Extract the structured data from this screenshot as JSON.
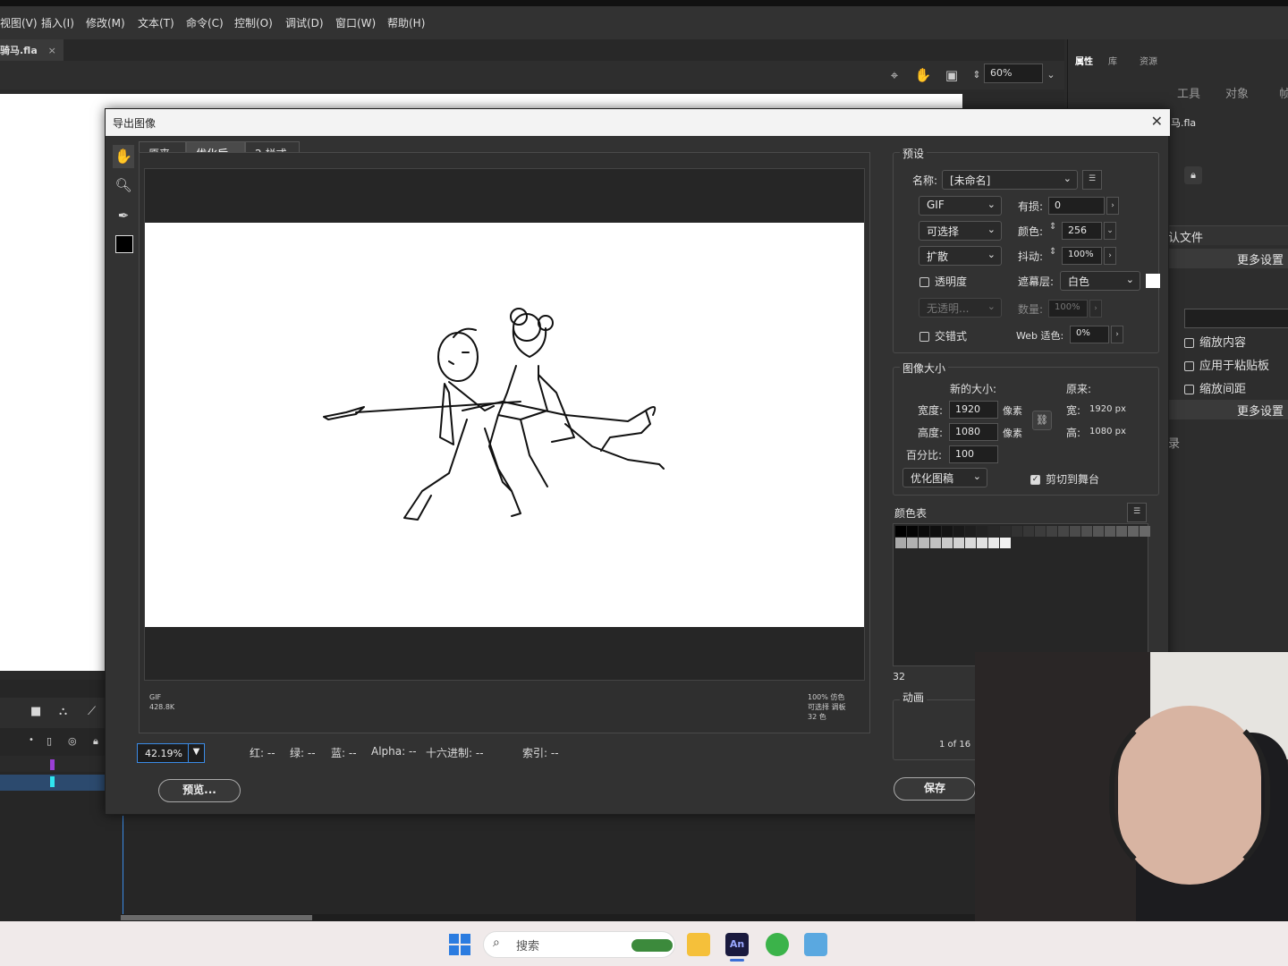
{
  "menubar": {
    "items": [
      "视图(V)",
      "插入(I)",
      "修改(M)",
      "文本(T)",
      "命令(C)",
      "控制(O)",
      "调试(D)",
      "窗口(W)",
      "帮助(H)"
    ]
  },
  "document": {
    "tab_label": "骑马.fla",
    "close_glyph": "×"
  },
  "toolbar": {
    "zoom_value": "60%"
  },
  "right_panel": {
    "tabs": [
      "属性",
      "库",
      "资源"
    ],
    "subtabs": [
      "工具",
      "对象",
      "帧"
    ],
    "file_name": "马.fla",
    "profile_label": "认文件",
    "more_settings_1": "更多设置",
    "scale_content": "缩放内容",
    "apply_clipboard": "应用于粘贴板",
    "scale_spacing": "缩放间距",
    "more_settings_2": "更多设置",
    "partial_label": "录"
  },
  "dialog": {
    "title": "导出图像",
    "close": "✕",
    "view_tabs": [
      "原来",
      "优化后",
      "2 栏式"
    ],
    "active_tab": 1,
    "preview_info_left": [
      "GIF",
      "428.8K"
    ],
    "preview_info_right": [
      "100% 仿色",
      "可选择 调板",
      "32 色"
    ],
    "zoom": "42.19%",
    "readouts": {
      "red": "红: --",
      "green": "绿: --",
      "blue": "蓝: --",
      "alpha": "Alpha: --",
      "hex": "十六进制: --",
      "index": "索引: --"
    },
    "preview_button": "预览...",
    "save_button": "保存",
    "preset": {
      "section": "预设",
      "name_label": "名称:",
      "name_value": "[未命名]",
      "format": "GIF",
      "lossy_label": "有损:",
      "lossy_value": "0",
      "palette": "可选择",
      "colors_label": "颜色:",
      "colors_value": "256",
      "dither_type": "扩散",
      "dither_label": "抖动:",
      "dither_value": "100%",
      "transparency_label": "透明度",
      "matte_label": "遮幕层:",
      "matte_value": "白色",
      "no_transparency": "无透明...",
      "amount_label": "数量:",
      "amount_value": "100%",
      "interlaced_label": "交错式",
      "web_snap_label": "Web 适色:",
      "web_snap_value": "0%"
    },
    "image_size": {
      "section": "图像大小",
      "new_size": "新的大小:",
      "original": "原来:",
      "width_label": "宽度:",
      "width_value": "1920",
      "height_label": "高度:",
      "height_value": "1080",
      "unit": "像素",
      "orig_w_label": "宽:",
      "orig_w_value": "1920 px",
      "orig_h_label": "高:",
      "orig_h_value": "1080 px",
      "percent_label": "百分比:",
      "percent_value": "100",
      "resample": "优化图稿",
      "clip_label": "剪切到舞台"
    },
    "color_table": {
      "section": "颜色表",
      "count": "32"
    },
    "animation": {
      "section": "动画",
      "frame": "1 of 16"
    }
  },
  "taskbar": {
    "search_placeholder": "搜索"
  },
  "colors": {
    "accent": "#3b8be6",
    "dialog_bg": "#323232",
    "panel_bg": "#2d2d2d"
  }
}
